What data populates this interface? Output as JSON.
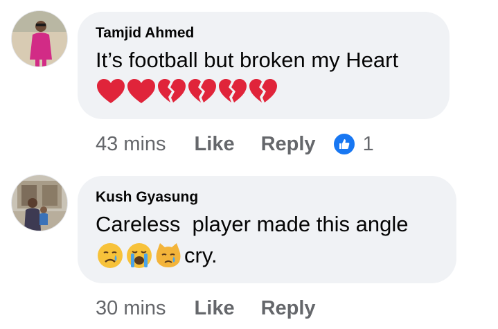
{
  "comments": [
    {
      "author": "Tamjid Ahmed",
      "text": "It’s football but broken my Heart",
      "emoji_icons": [
        "red-heart-icon",
        "red-heart-icon",
        "broken-heart-icon",
        "broken-heart-icon",
        "broken-heart-icon",
        "broken-heart-icon"
      ],
      "time": "43 mins",
      "like_label": "Like",
      "reply_label": "Reply",
      "reaction_icon": "thumbs-up-icon",
      "reaction_count": "1"
    },
    {
      "author": "Kush Gyasung",
      "text": "Careless  player made this angle",
      "emoji_icons": [
        "crying-face-icon",
        "loudly-crying-face-icon",
        "crying-cat-face-icon"
      ],
      "emoji_trailing_text": "cry.",
      "time": "30 mins",
      "like_label": "Like",
      "reply_label": "Reply"
    }
  ],
  "colors": {
    "bubble": "#f0f2f5",
    "secondary_text": "#65676b",
    "like_blue": "#1877f2",
    "heart_red": "#e0243a"
  }
}
